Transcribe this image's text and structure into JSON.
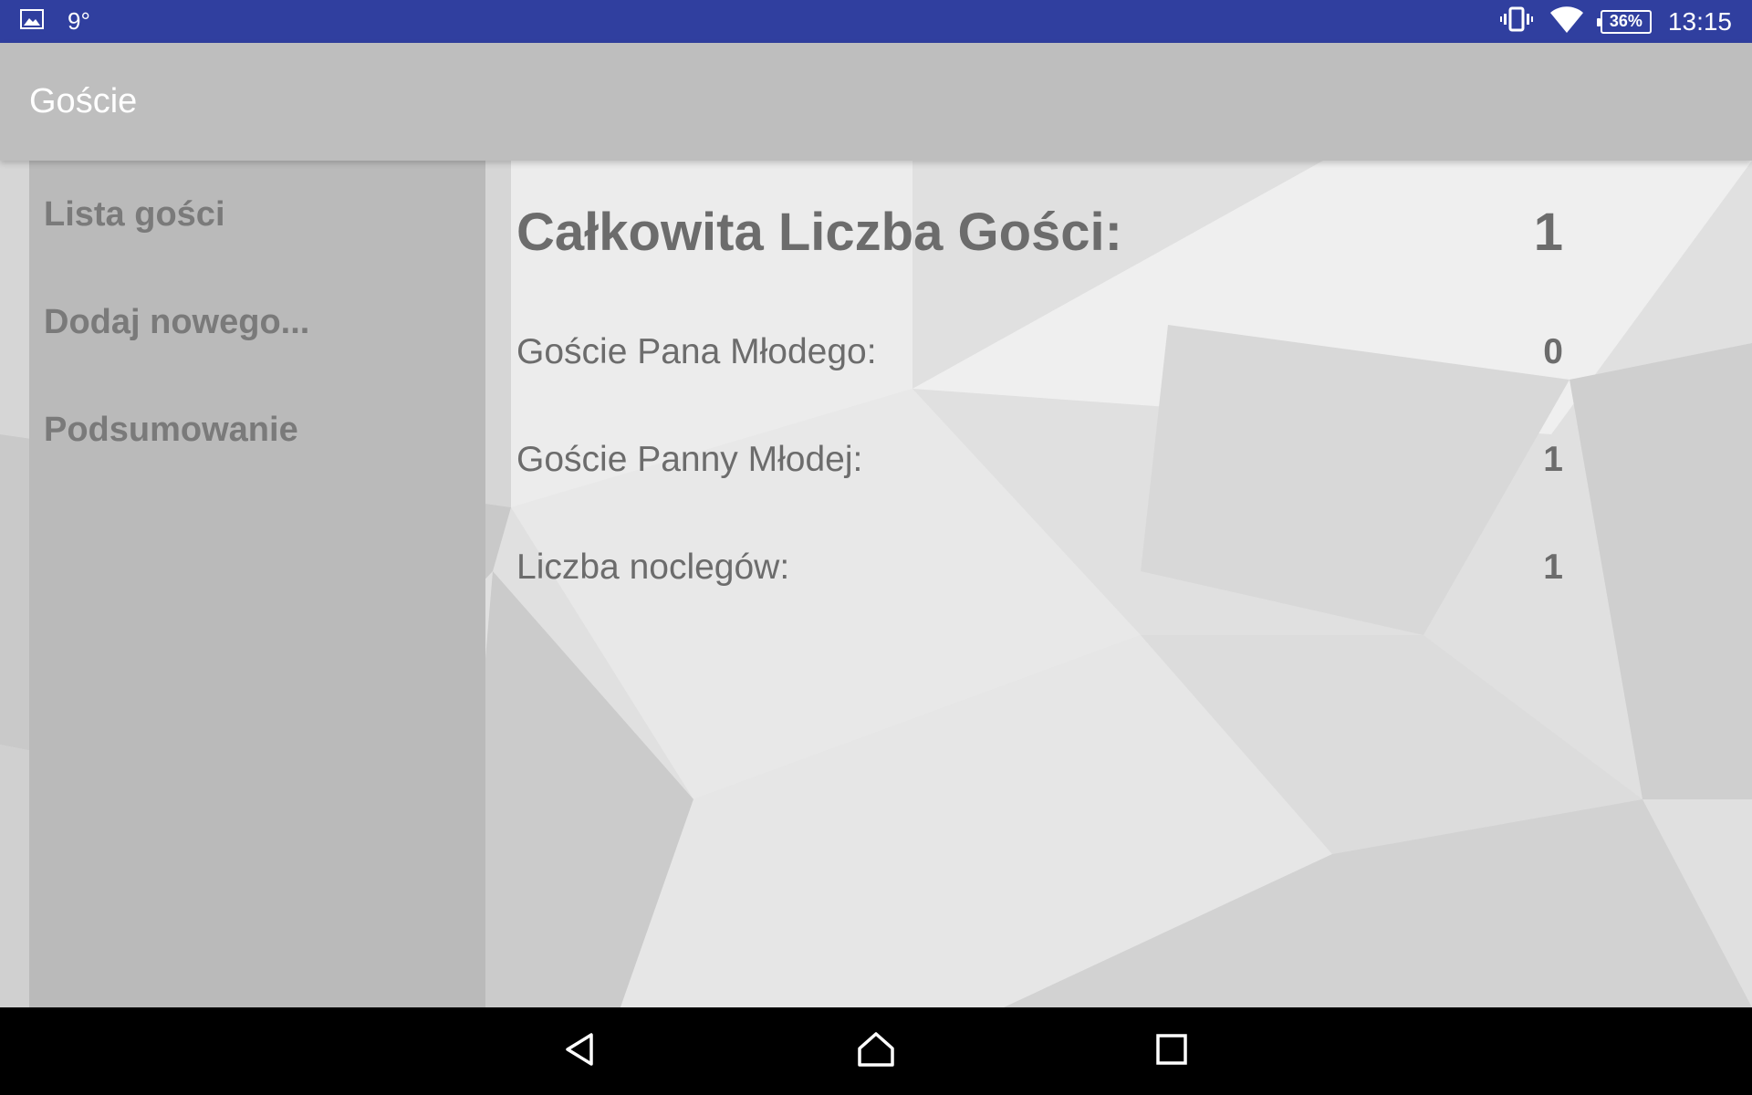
{
  "status_bar": {
    "temperature": "9°",
    "battery": "36%",
    "time": "13:15"
  },
  "app_bar": {
    "title": "Goście"
  },
  "sidebar": {
    "items": [
      {
        "label": "Lista gości"
      },
      {
        "label": "Dodaj nowego..."
      },
      {
        "label": "Podsumowanie"
      }
    ]
  },
  "summary": {
    "total": {
      "label": "Całkowita Liczba Gości:",
      "value": "1"
    },
    "groom_guests": {
      "label": "Goście Pana Młodego:",
      "value": "0"
    },
    "bride_guests": {
      "label": "Goście Panny Młodej:",
      "value": "1"
    },
    "overnight_stays": {
      "label": "Liczba noclegów:",
      "value": "1"
    }
  },
  "icons": {
    "status_left": [
      "image-icon"
    ],
    "status_right": [
      "vibrate-icon",
      "wifi-icon",
      "battery-icon"
    ],
    "nav": [
      "back-icon",
      "home-icon",
      "recents-icon"
    ]
  }
}
